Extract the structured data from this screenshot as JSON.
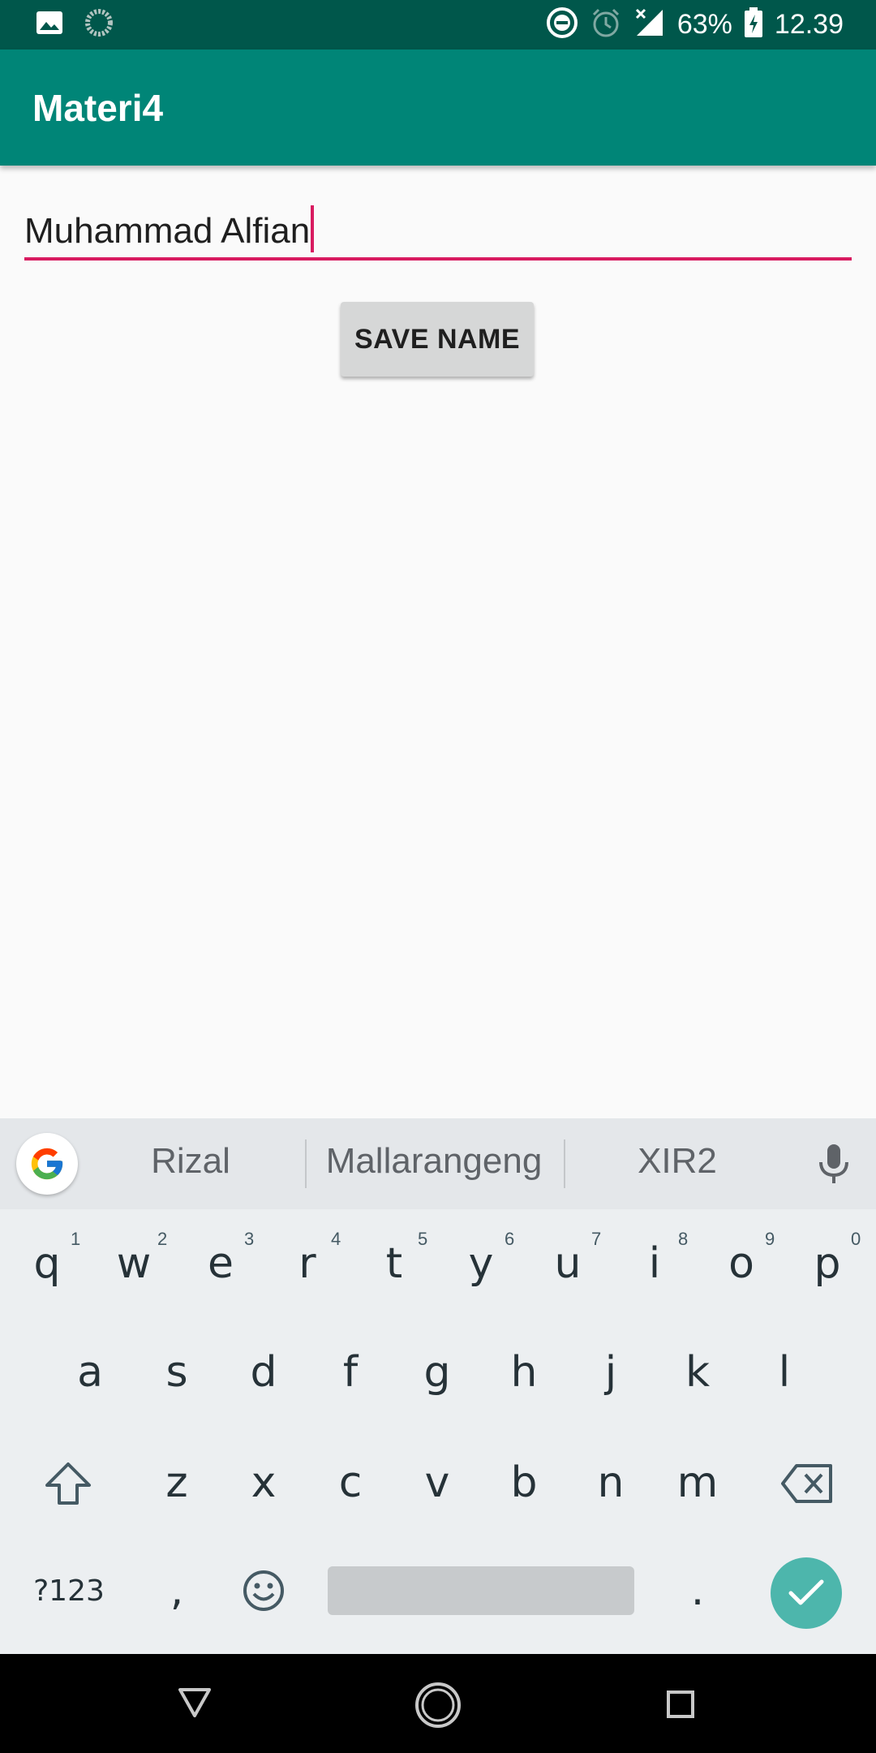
{
  "status_bar": {
    "battery": "63%",
    "time": "12.39",
    "icons": [
      "image-notification-icon",
      "sync-notification-icon",
      "do-not-disturb-icon",
      "alarm-icon",
      "signal-icon",
      "battery-charging-icon"
    ]
  },
  "app_bar": {
    "title": "Materi4"
  },
  "form": {
    "name_value": "Muhammad Alfian",
    "save_button_label": "SAVE NAME"
  },
  "keyboard": {
    "suggestions": [
      "Rizal",
      "Mallarangeng",
      "XIR2"
    ],
    "row1": [
      "q",
      "w",
      "e",
      "r",
      "t",
      "y",
      "u",
      "i",
      "o",
      "p"
    ],
    "row1_hints": [
      "1",
      "2",
      "3",
      "4",
      "5",
      "6",
      "7",
      "8",
      "9",
      "0"
    ],
    "row2": [
      "a",
      "s",
      "d",
      "f",
      "g",
      "h",
      "j",
      "k",
      "l"
    ],
    "row3": [
      "z",
      "x",
      "c",
      "v",
      "b",
      "n",
      "m"
    ],
    "symbols_key": "?123",
    "comma_key": ",",
    "period_key": ".",
    "accent_color": "#4db6ac"
  },
  "colors": {
    "primary": "#008577",
    "primary_dark": "#00574b",
    "accent": "#d81b60"
  }
}
